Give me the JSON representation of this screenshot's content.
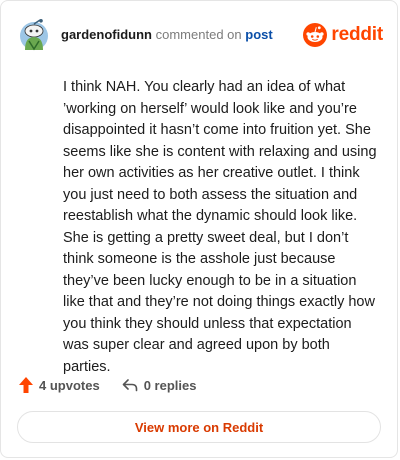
{
  "comment": {
    "username": "gardenofidunn",
    "action_text": "commented on",
    "post_link": "post",
    "body": "I think NAH. You clearly had an idea of what ’working on herself’ would look like and you’re disappointed it hasn’t come into fruition yet. She seems like she is content with relaxing and using her own activities as her creative outlet. I think you just need to both assess the situation and reestablish what the dynamic should look like. She is getting a pretty sweet deal, but I don’t think someone is the asshole just because they’ve been lucky enough to be in a situation like that and they’re not doing things exactly how you think they should unless that expectation was super clear and agreed upon by both parties."
  },
  "brand": {
    "name": "reddit",
    "color": "#ff4500"
  },
  "actions": {
    "upvotes": "4 upvotes",
    "replies": "0 replies"
  },
  "view_more": "View more on Reddit",
  "icons": [
    "avatar-icon",
    "reddit-logo-icon",
    "upvote-icon",
    "reply-icon"
  ]
}
